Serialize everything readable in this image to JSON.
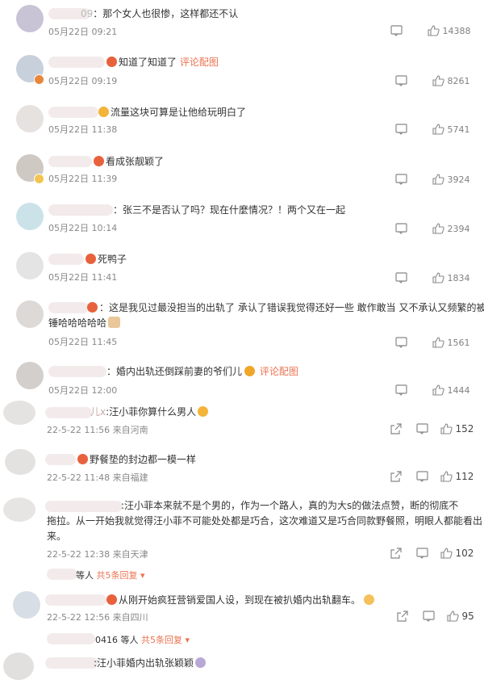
{
  "comments": [
    {
      "name_suffix": "09",
      "text": "：那个女人也很惨，这样都还不认",
      "date": "05月22日 09:21",
      "likes": "14388"
    },
    {
      "text": "知道了知道了",
      "link": "评论配图",
      "date": "05月22日 09:19",
      "likes": "8261"
    },
    {
      "text": "流量这块可算是让他给玩明白了",
      "date": "05月22日 11:38",
      "likes": "5741"
    },
    {
      "text": "看成张靓颖了",
      "date": "05月22日 11:39",
      "likes": "3924"
    },
    {
      "text": "：张三不是否认了吗？现在什麼情况？！两个又在一起",
      "date": "05月22日 10:14",
      "likes": "2394"
    },
    {
      "text": "死鸭子",
      "date": "05月22日 11:41",
      "likes": "1834"
    },
    {
      "text": "：这是我见过最没担当的出轨了 承认了错误我觉得还好一些 敢作敢当 又不承认又频繁的被实",
      "text2": "锤哈哈哈哈哈",
      "date": "05月22日 11:45",
      "likes": "1561"
    },
    {
      "text": "：婚内出轨还倒踩前妻的爷们儿",
      "link": "评论配图",
      "date": "05月22日 12:00",
      "likes": "1444"
    },
    {
      "name_suffix": "儿x",
      "text": ":汪小菲你算什么男人",
      "date": "22-5-22 11:56 来自河南",
      "likes": "152"
    },
    {
      "text": "野餐垫的封边都一模一样",
      "date": "22-5-22 11:48 来自福建",
      "likes": "112"
    },
    {
      "text": ":汪小菲本来就不是个男的，作为一个路人，真的为大s的做法点赞，断的彻底不",
      "text2": "拖拉。从一开始我就觉得汪小菲不可能处处都是巧合，这次难道又是巧合同款野餐照，明眼人都能看出",
      "text3": "来。",
      "date": "22-5-22 12:38 来自天津",
      "likes": "102"
    },
    {
      "replies_prefix": "等人",
      "replies_more": "共5条回复 ▾"
    },
    {
      "text": "从刚开始疯狂营销爱国人设，到现在被扒婚内出轨翻车。",
      "date": "22-5-22 12:56 来自四川",
      "likes": "95"
    },
    {
      "replies_prefix": "0416 等人",
      "replies_more": "共5条回复 ▾"
    },
    {
      "text": ":汪小菲婚内出轨张颖颖"
    }
  ],
  "icons": {
    "comment": "comment-icon",
    "like": "thumbs-up-icon",
    "share": "share-icon",
    "emoji_face": "emoji-face-icon"
  },
  "colors": {
    "link": "#eb7350",
    "meta": "#888888",
    "text": "#333333"
  }
}
